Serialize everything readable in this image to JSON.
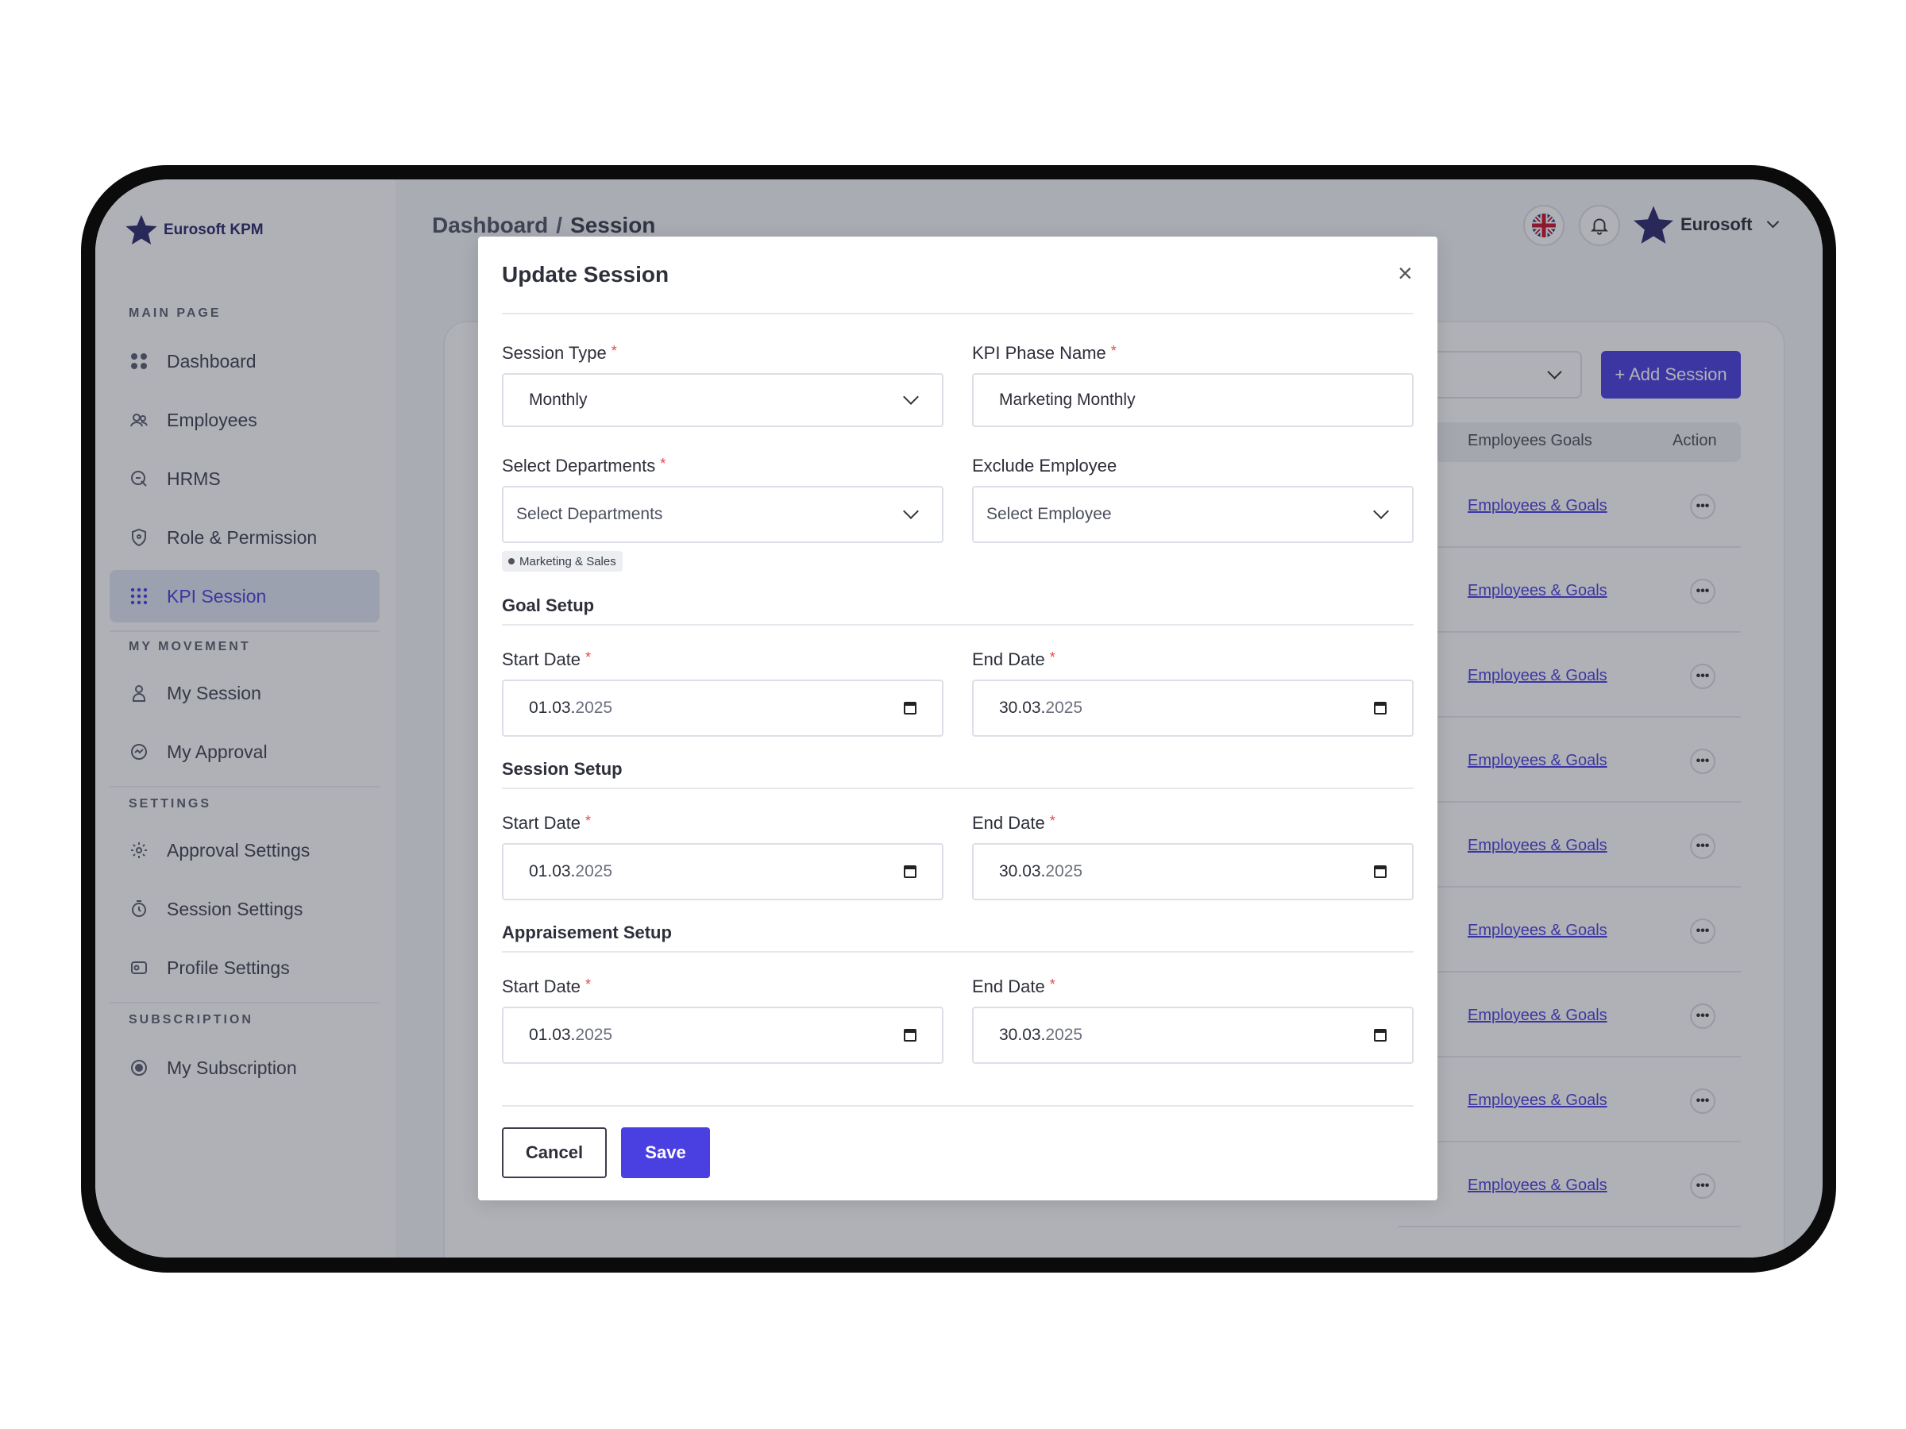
{
  "app": {
    "logo_text": "Eurosoft KPM"
  },
  "breadcrumb": {
    "parent": "Dashboard",
    "separator": "/",
    "current": "Session"
  },
  "user": {
    "name": "Eurosoft"
  },
  "sidebar": {
    "sections": [
      {
        "title": "MAIN PAGE"
      },
      {
        "title": "MY MOVEMENT"
      },
      {
        "title": "SETTINGS"
      },
      {
        "title": "SUBSCRIPTION"
      }
    ],
    "items": [
      {
        "label": "Dashboard",
        "icon": "dashboard-icon"
      },
      {
        "label": "Employees",
        "icon": "users-icon"
      },
      {
        "label": "HRMS",
        "icon": "hrms-icon"
      },
      {
        "label": "Role & Permission",
        "icon": "shield-icon"
      },
      {
        "label": "KPI Session",
        "icon": "grid-icon",
        "active": true
      },
      {
        "label": "My Session",
        "icon": "user-icon"
      },
      {
        "label": "My Approval",
        "icon": "approval-icon"
      },
      {
        "label": "Approval Settings",
        "icon": "gear-icon"
      },
      {
        "label": "Session Settings",
        "icon": "clock-icon"
      },
      {
        "label": "Profile Settings",
        "icon": "profile-icon"
      },
      {
        "label": "My Subscription",
        "icon": "subscription-icon"
      }
    ]
  },
  "toolbar": {
    "add_session_label": "+ Add Session"
  },
  "table": {
    "headers": {
      "goals": "Employees Goals",
      "action": "Action"
    },
    "rows": [
      {
        "link": "Employees & Goals"
      },
      {
        "link": "Employees & Goals"
      },
      {
        "link": "Employees & Goals"
      },
      {
        "link": "Employees & Goals"
      },
      {
        "link": "Employees & Goals"
      },
      {
        "link": "Employees & Goals"
      },
      {
        "link": "Employees & Goals"
      },
      {
        "link": "Employees & Goals"
      },
      {
        "link": "Employees & Goals"
      }
    ],
    "row_action_glyph": "•••"
  },
  "modal": {
    "title": "Update Session",
    "close_glyph": "×",
    "session_type": {
      "label": "Session Type",
      "value": "Monthly"
    },
    "kpi_phase_name": {
      "label": "KPI Phase Name",
      "value": "Marketing Monthly"
    },
    "departments": {
      "label": "Select Departments",
      "placeholder": "Select Departments",
      "tag": "Marketing & Sales"
    },
    "exclude_employee": {
      "label": "Exclude Employee",
      "placeholder": "Select Employee"
    },
    "goal_setup": {
      "title": "Goal Setup",
      "start_label": "Start Date",
      "start_day": "01.03.",
      "start_year": "2025",
      "end_label": "End Date",
      "end_day": "30.03.",
      "end_year": "2025"
    },
    "session_setup": {
      "title": "Session Setup",
      "start_label": "Start Date",
      "start_day": "01.03.",
      "start_year": "2025",
      "end_label": "End Date",
      "end_day": "30.03.",
      "end_year": "2025"
    },
    "appraisement_setup": {
      "title": "Appraisement Setup",
      "start_label": "Start Date",
      "start_day": "01.03.",
      "start_year": "2025",
      "end_label": "End Date",
      "end_day": "30.03.",
      "end_year": "2025"
    },
    "required_mark": "*",
    "cancel_label": "Cancel",
    "save_label": "Save"
  },
  "colors": {
    "accent": "#4a3fe0",
    "required": "#e5484d",
    "brand": "#2b2a6e"
  }
}
